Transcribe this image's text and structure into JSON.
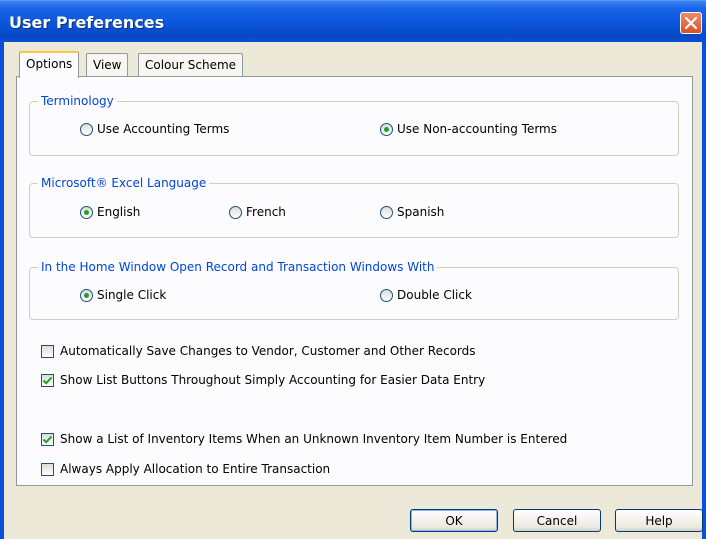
{
  "window": {
    "title": "User Preferences"
  },
  "tabs": [
    {
      "label": "Options",
      "active": true
    },
    {
      "label": "View",
      "active": false
    },
    {
      "label": "Colour Scheme",
      "active": false
    }
  ],
  "terminology": {
    "legend": "Terminology",
    "options": [
      {
        "label": "Use Accounting Terms",
        "selected": false
      },
      {
        "label": "Use Non-accounting Terms",
        "selected": true
      }
    ]
  },
  "excel_language": {
    "legend": "Microsoft® Excel Language",
    "options": [
      {
        "label": "English",
        "selected": true
      },
      {
        "label": "French",
        "selected": false
      },
      {
        "label": "Spanish",
        "selected": false
      }
    ]
  },
  "home_window": {
    "legend": "In the Home Window Open Record and Transaction Windows With",
    "options": [
      {
        "label": "Single Click",
        "selected": true
      },
      {
        "label": "Double Click",
        "selected": false
      }
    ]
  },
  "checkboxes": [
    {
      "label": "Automatically Save Changes to Vendor, Customer and Other Records",
      "checked": false
    },
    {
      "label": "Show List Buttons Throughout Simply Accounting for Easier Data Entry",
      "checked": true
    },
    {
      "label": "Show a List of Inventory Items When an Unknown Inventory Item Number is Entered",
      "checked": true
    },
    {
      "label": "Always Apply Allocation to Entire Transaction",
      "checked": false
    }
  ],
  "buttons": {
    "ok": "OK",
    "cancel": "Cancel",
    "help": "Help"
  },
  "colors": {
    "title_bar": "#0a55dc",
    "legend_text": "#0046d5",
    "check_mark": "#21a121",
    "close_button": "#d9502a"
  }
}
